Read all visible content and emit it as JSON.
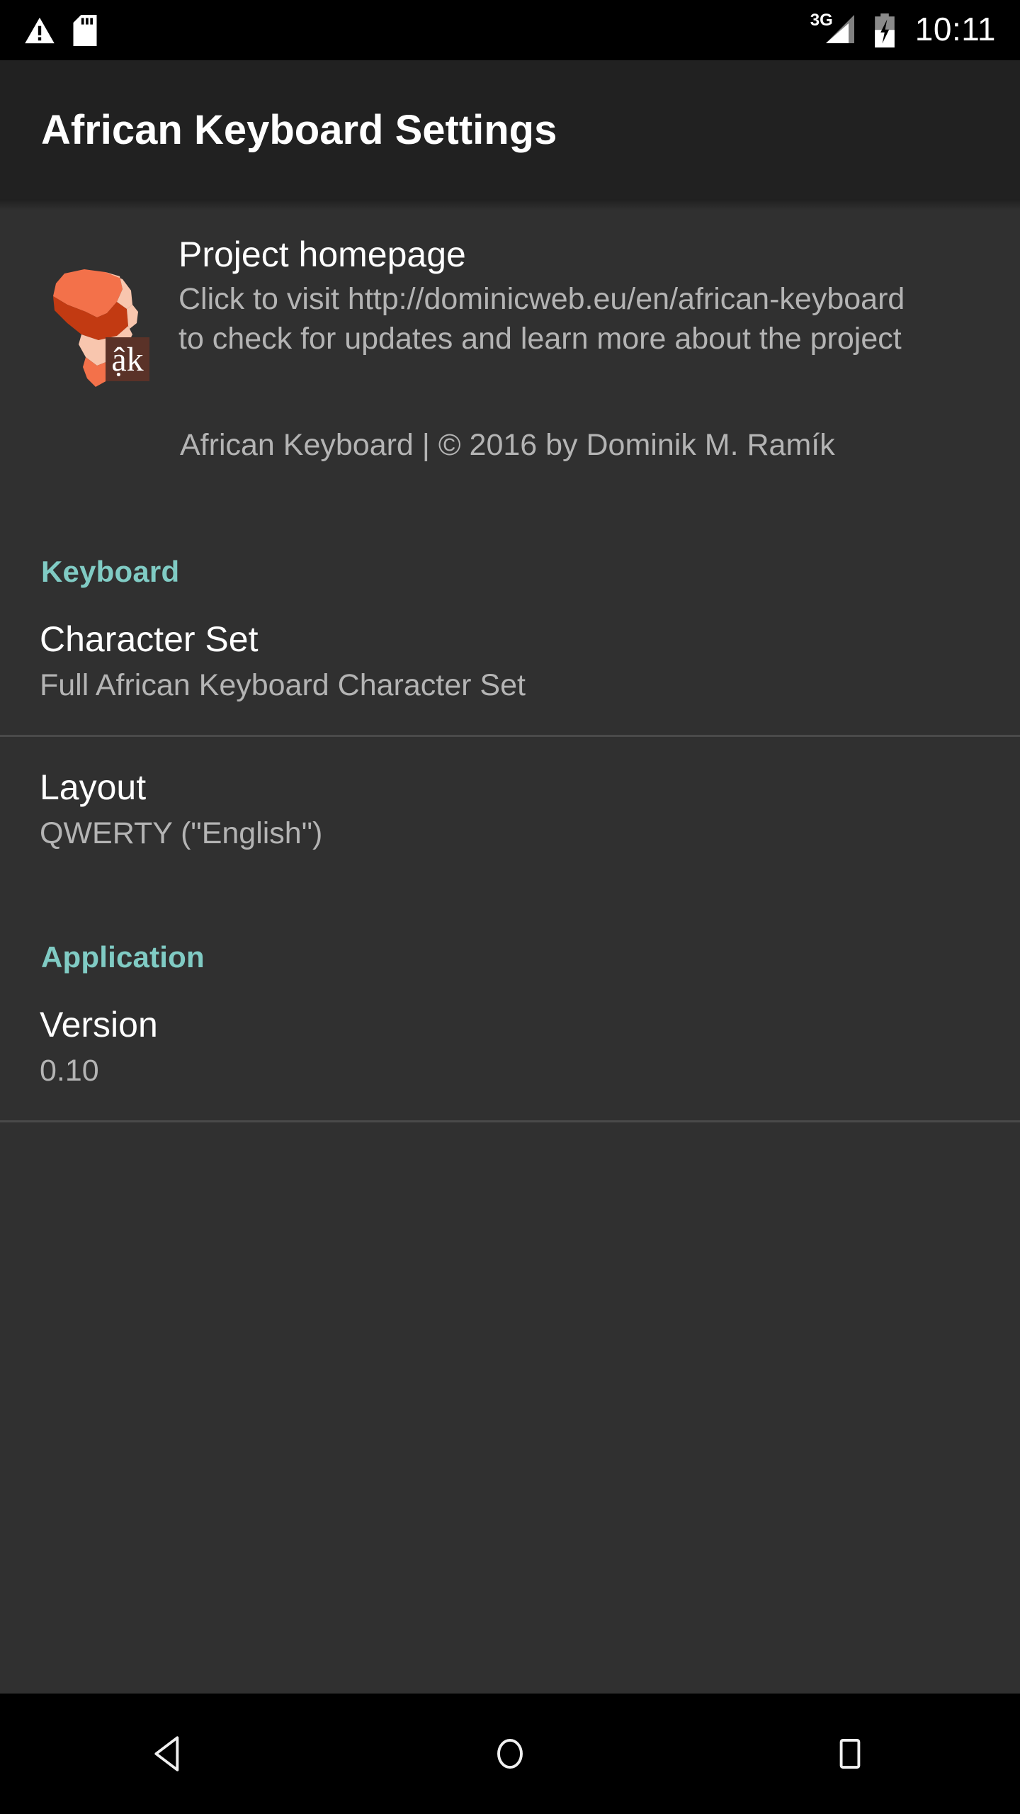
{
  "statusbar": {
    "left_icons": [
      {
        "name": "warning-icon",
        "label": "warning"
      },
      {
        "name": "sdcard-icon",
        "label": "sd-card"
      }
    ],
    "network_label": "3G",
    "signal_icon": "signal-bars-icon",
    "battery_icon": "battery-charging-icon",
    "clock": "10:11"
  },
  "actionbar": {
    "title": "African Keyboard Settings"
  },
  "homepage_pref": {
    "icon_name": "african-keyboard-logo",
    "icon_badge_text": "ậk",
    "title": "Project homepage",
    "summary": "Click to visit http://dominicweb.eu/en/african-keyboard to check for updates and learn more about the project",
    "copyright": "African Keyboard | © 2016 by Dominik M. Ramík"
  },
  "sections": [
    {
      "header": "Keyboard",
      "rows": [
        {
          "title": "Character Set",
          "summary": "Full African Keyboard Character Set"
        },
        {
          "title": "Layout",
          "summary": "QWERTY (\"English\")"
        }
      ]
    },
    {
      "header": "Application",
      "rows": [
        {
          "title": "Version",
          "summary": "0.10"
        }
      ]
    }
  ],
  "navbar": {
    "back_label": "Back",
    "home_label": "Home",
    "recents_label": "Recent apps"
  },
  "colors": {
    "accent_teal": "#80cbc4",
    "actionbar_bg": "#212121",
    "content_bg": "#303030",
    "primary_text": "#ffffff",
    "secondary_text": "#b4b4b4",
    "divider": "#4a4a4a",
    "logo_orange_light": "#f3714a",
    "logo_orange_dark": "#c23a12",
    "logo_peach": "#f8c6ae",
    "logo_badge_bg": "#5a3228"
  }
}
